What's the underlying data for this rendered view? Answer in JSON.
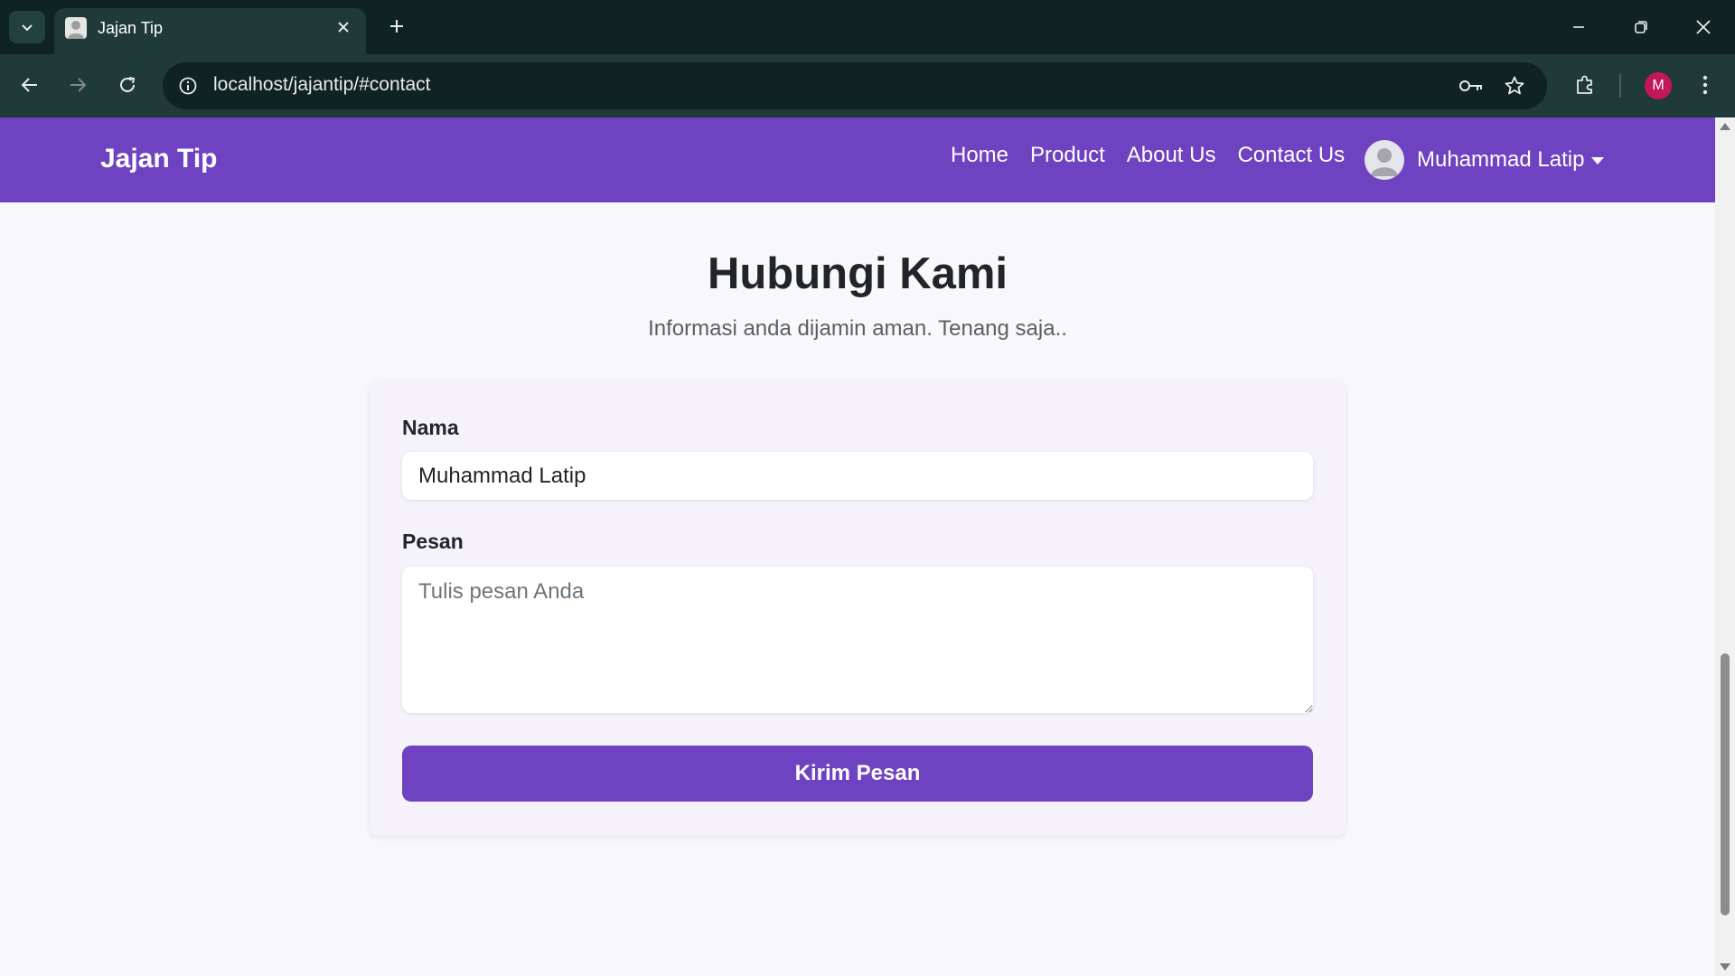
{
  "browser": {
    "tab_title": "Jajan Tip",
    "url": "localhost/jajantip/#contact",
    "profile_initial": "M"
  },
  "site": {
    "brand": "Jajan Tip",
    "nav": [
      "Home",
      "Product",
      "About Us",
      "Contact Us"
    ],
    "user_name": "Muhammad Latip"
  },
  "contact": {
    "title": "Hubungi Kami",
    "subtitle": "Informasi anda dijamin aman. Tenang saja..",
    "name_label": "Nama",
    "name_value": "Muhammad Latip",
    "message_label": "Pesan",
    "message_placeholder": "Tulis pesan Anda",
    "submit_label": "Kirim Pesan"
  },
  "colors": {
    "accent": "#6f42c1",
    "chrome_dark": "#0e2322",
    "chrome_toolbar": "#1f3a38",
    "page_bg": "#f8f7fb",
    "profile": "#c2185b"
  },
  "icons": {
    "tab_search": "chevron-down-icon",
    "tab_close": "close-icon",
    "new_tab": "plus-icon",
    "back": "arrow-left-icon",
    "forward": "arrow-right-icon",
    "reload": "reload-icon",
    "site_info": "info-icon",
    "password": "key-icon",
    "bookmark": "star-icon",
    "extensions": "puzzle-icon",
    "menu": "kebab-menu-icon"
  }
}
